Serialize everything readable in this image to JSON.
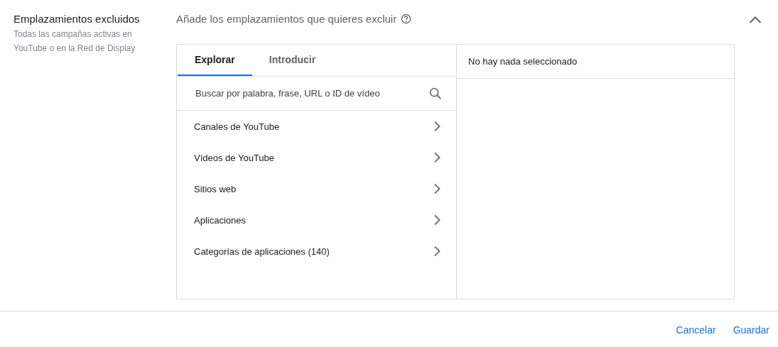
{
  "section": {
    "title": "Emplazamientos excluidos",
    "description": "Todas las campañas activas en YouTube o en la Red de Display",
    "heading": "Añade los emplazamientos que quieres excluir",
    "expanded": true
  },
  "tabs": [
    {
      "label": "Explorar",
      "selected": true
    },
    {
      "label": "Introducir",
      "selected": false
    }
  ],
  "search": {
    "placeholder": "Buscar por palabra, frase, URL o ID de vídeo"
  },
  "categories": [
    {
      "label": "Canales de YouTube"
    },
    {
      "label": "Vídeos de YouTube"
    },
    {
      "label": "Sitios web"
    },
    {
      "label": "Aplicaciones"
    },
    {
      "label": "Categorías de aplicaciones (140)"
    }
  ],
  "selection": {
    "empty_text": "No hay nada seleccionado"
  },
  "buttons": [
    {
      "label": "Cancelar"
    },
    {
      "label": "Guardar"
    }
  ]
}
